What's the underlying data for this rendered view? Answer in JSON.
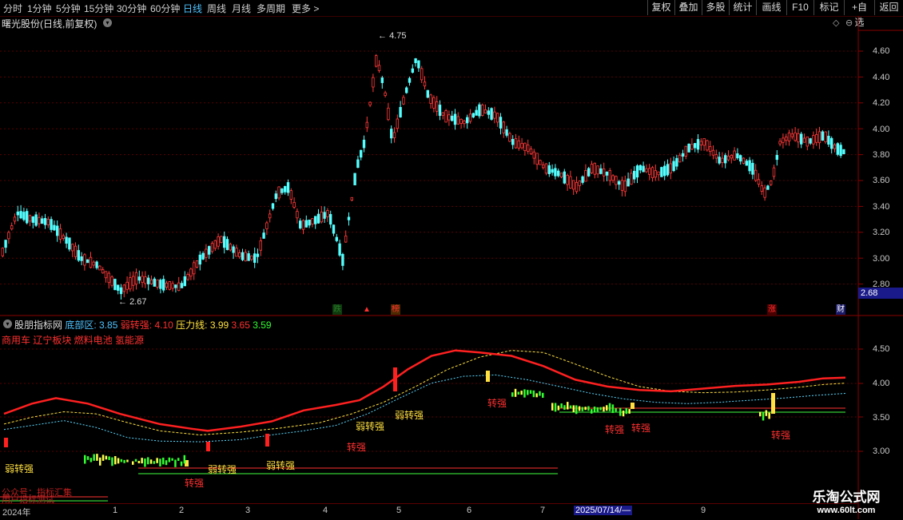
{
  "toolbar": {
    "periods": [
      "分时",
      "1分钟",
      "5分钟",
      "15分钟",
      "30分钟",
      "60分钟",
      "日线",
      "周线",
      "月线",
      "多周期",
      "更多"
    ],
    "active_period": "日线",
    "buttons": [
      "复权",
      "叠加",
      "多股",
      "统计",
      "画线",
      "F10",
      "+自选",
      "标记",
      "返回"
    ]
  },
  "stock_title": "曙光股份(日线,前复权)",
  "price_axis": [
    "4.60",
    "4.40",
    "4.20",
    "4.00",
    "3.80",
    "3.60",
    "3.40",
    "3.20",
    "3.00",
    "2.80"
  ],
  "current_price": "2.68",
  "high_label": "4.75",
  "low_label": "2.67",
  "events": [
    {
      "text": "跌",
      "color": "#2a7a2a",
      "bg": "#0e3a0e"
    },
    {
      "text": "▲",
      "color": "#ff3030",
      "bg": "#000"
    },
    {
      "text": "榜",
      "color": "#ff3030",
      "bg": "#4a2a00"
    },
    {
      "text": "涨",
      "color": "#ff3030",
      "bg": "#4a0000"
    },
    {
      "text": "财",
      "color": "#ffffff",
      "bg": "#1a1a6a"
    }
  ],
  "indicator": {
    "name": "股朋指标网",
    "bottom_label": "底部区:",
    "bottom_value": "3.85",
    "weak_label": "弱转强:",
    "weak_value": "4.10",
    "pressure_label": "压力线:",
    "pressure_value": "3.99",
    "v4": "3.65",
    "v5": "3.59",
    "sectors": "商用车 辽宁板块 燃料电池 氢能源",
    "axis": [
      "4.50",
      "4.00",
      "3.50",
      "3.00"
    ]
  },
  "signals": {
    "weak_to_strong": "弱转强",
    "to_strong": "转强"
  },
  "watermark_text": "公众号：指标汇集",
  "watermark_text2": "用户指标测试",
  "dates": [
    "2024年",
    "1",
    "2",
    "3",
    "4",
    "5",
    "6",
    "7",
    "2025/07/14/—",
    "9"
  ],
  "logo": {
    "title": "乐淘公式网",
    "url": "www.60lt.com"
  }
}
